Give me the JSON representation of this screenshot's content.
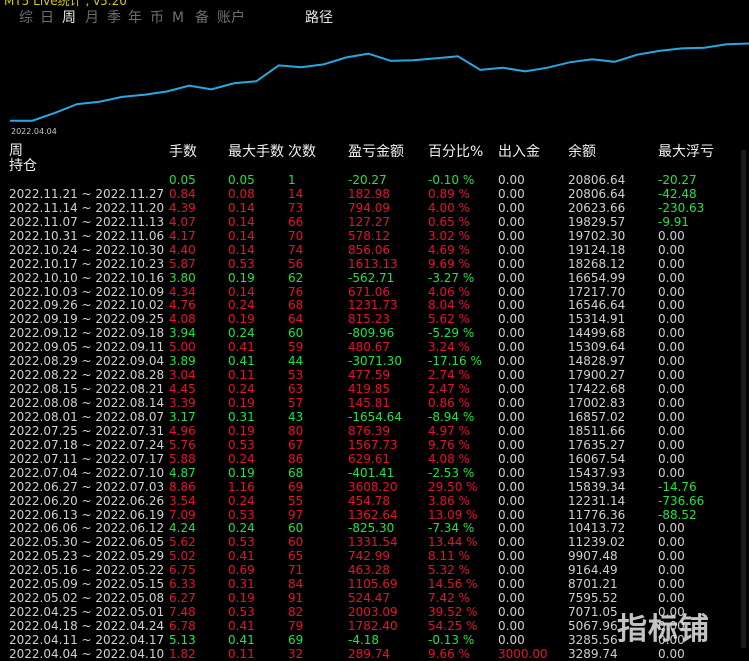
{
  "app": {
    "title_fragment": "MT5 Live统计 , v5.20"
  },
  "tabs": [
    {
      "label": "综"
    },
    {
      "label": "日"
    },
    {
      "label": "周"
    },
    {
      "label": "月"
    },
    {
      "label": "季"
    },
    {
      "label": "年"
    },
    {
      "label": "币"
    },
    {
      "label": "M"
    },
    {
      "label": "备"
    },
    {
      "label": "账户"
    },
    {
      "label": "路径"
    }
  ],
  "chart": {
    "start_date_label": "2022.04.04",
    "line_color": "#29a8e0"
  },
  "chart_data": {
    "type": "line",
    "title": "",
    "xlabel": "",
    "ylabel": "",
    "x_start_label": "2022.04.04",
    "x": [
      "2022.04.04",
      "2022.04.11",
      "2022.04.18",
      "2022.04.25",
      "2022.05.02",
      "2022.05.09",
      "2022.05.16",
      "2022.05.23",
      "2022.05.30",
      "2022.06.06",
      "2022.06.13",
      "2022.06.20",
      "2022.06.27",
      "2022.07.04",
      "2022.07.11",
      "2022.07.18",
      "2022.07.25",
      "2022.08.01",
      "2022.08.08",
      "2022.08.15",
      "2022.08.22",
      "2022.08.29",
      "2022.09.05",
      "2022.09.12",
      "2022.09.19",
      "2022.09.26",
      "2022.10.03",
      "2022.10.10",
      "2022.10.17",
      "2022.10.24",
      "2022.10.31",
      "2022.11.07",
      "2022.11.14",
      "2022.11.21"
    ],
    "series": [
      {
        "values": [
          3289.74,
          3285.56,
          5067.96,
          7071.05,
          7595.52,
          8701.21,
          9164.49,
          9907.48,
          11239.02,
          10413.72,
          11776.36,
          12231.14,
          15839.34,
          15437.93,
          16067.54,
          17635.27,
          18511.66,
          16857.02,
          17002.83,
          17422.68,
          17900.27,
          14828.97,
          15309.64,
          14499.68,
          15314.91,
          16546.64,
          17217.7,
          16654.99,
          18268.12,
          19124.18,
          19702.3,
          19829.57,
          20623.66,
          20806.64
        ]
      }
    ]
  },
  "table": {
    "headers": {
      "period_top": "周",
      "period_bottom": "持仓",
      "lots": "手数",
      "max_lots": "最大手数",
      "count": "次数",
      "pnl": "盈亏金额",
      "pct": "百分比%",
      "io": "出入金",
      "balance": "余额",
      "max_float": "最大浮亏"
    },
    "rows": [
      {
        "period": "",
        "lots": "0.05",
        "max_lots": "0.05",
        "count": "1",
        "pnl": "-20.27",
        "pct": "-0.10 %",
        "io": "0.00",
        "balance": "20806.64",
        "max_float": "-20.27",
        "color": "g",
        "fcolor": "g"
      },
      {
        "period": "2022.11.21 ~ 2022.11.27",
        "lots": "0.84",
        "max_lots": "0.08",
        "count": "14",
        "pnl": "182.98",
        "pct": "0.89 %",
        "io": "0.00",
        "balance": "20806.64",
        "max_float": "-42.48",
        "color": "r",
        "fcolor": "g"
      },
      {
        "period": "2022.11.14 ~ 2022.11.20",
        "lots": "4.39",
        "max_lots": "0.14",
        "count": "73",
        "pnl": "794.09",
        "pct": "4.00 %",
        "io": "0.00",
        "balance": "20623.66",
        "max_float": "-230.63",
        "color": "r",
        "fcolor": "g"
      },
      {
        "period": "2022.11.07 ~ 2022.11.13",
        "lots": "4.07",
        "max_lots": "0.14",
        "count": "66",
        "pnl": "127.27",
        "pct": "0.65 %",
        "io": "0.00",
        "balance": "19829.57",
        "max_float": "-9.91",
        "color": "r",
        "fcolor": "g"
      },
      {
        "period": "2022.10.31 ~ 2022.11.06",
        "lots": "4.17",
        "max_lots": "0.14",
        "count": "70",
        "pnl": "578.12",
        "pct": "3.02 %",
        "io": "0.00",
        "balance": "19702.30",
        "max_float": "0.00",
        "color": "r",
        "fcolor": "w"
      },
      {
        "period": "2022.10.24 ~ 2022.10.30",
        "lots": "4.40",
        "max_lots": "0.14",
        "count": "74",
        "pnl": "856.06",
        "pct": "4.69 %",
        "io": "0.00",
        "balance": "19124.18",
        "max_float": "0.00",
        "color": "r",
        "fcolor": "w"
      },
      {
        "period": "2022.10.17 ~ 2022.10.23",
        "lots": "5.87",
        "max_lots": "0.53",
        "count": "56",
        "pnl": "1613.13",
        "pct": "9.69 %",
        "io": "0.00",
        "balance": "18268.12",
        "max_float": "0.00",
        "color": "r",
        "fcolor": "w"
      },
      {
        "period": "2022.10.10 ~ 2022.10.16",
        "lots": "3.80",
        "max_lots": "0.19",
        "count": "62",
        "pnl": "-562.71",
        "pct": "-3.27 %",
        "io": "0.00",
        "balance": "16654.99",
        "max_float": "0.00",
        "color": "g",
        "fcolor": "w"
      },
      {
        "period": "2022.10.03 ~ 2022.10.09",
        "lots": "4.34",
        "max_lots": "0.14",
        "count": "76",
        "pnl": "671.06",
        "pct": "4.06 %",
        "io": "0.00",
        "balance": "17217.70",
        "max_float": "0.00",
        "color": "r",
        "fcolor": "w"
      },
      {
        "period": "2022.09.26 ~ 2022.10.02",
        "lots": "4.76",
        "max_lots": "0.24",
        "count": "68",
        "pnl": "1231.73",
        "pct": "8.04 %",
        "io": "0.00",
        "balance": "16546.64",
        "max_float": "0.00",
        "color": "r",
        "fcolor": "w"
      },
      {
        "period": "2022.09.19 ~ 2022.09.25",
        "lots": "4.08",
        "max_lots": "0.19",
        "count": "64",
        "pnl": "815.23",
        "pct": "5.62 %",
        "io": "0.00",
        "balance": "15314.91",
        "max_float": "0.00",
        "color": "r",
        "fcolor": "w"
      },
      {
        "period": "2022.09.12 ~ 2022.09.18",
        "lots": "3.94",
        "max_lots": "0.24",
        "count": "60",
        "pnl": "-809.96",
        "pct": "-5.29 %",
        "io": "0.00",
        "balance": "14499.68",
        "max_float": "0.00",
        "color": "g",
        "fcolor": "w"
      },
      {
        "period": "2022.09.05 ~ 2022.09.11",
        "lots": "5.00",
        "max_lots": "0.41",
        "count": "59",
        "pnl": "480.67",
        "pct": "3.24 %",
        "io": "0.00",
        "balance": "15309.64",
        "max_float": "0.00",
        "color": "r",
        "fcolor": "w"
      },
      {
        "period": "2022.08.29 ~ 2022.09.04",
        "lots": "3.89",
        "max_lots": "0.41",
        "count": "44",
        "pnl": "-3071.30",
        "pct": "-17.16 %",
        "io": "0.00",
        "balance": "14828.97",
        "max_float": "0.00",
        "color": "g",
        "fcolor": "w"
      },
      {
        "period": "2022.08.22 ~ 2022.08.28",
        "lots": "3.04",
        "max_lots": "0.11",
        "count": "53",
        "pnl": "477.59",
        "pct": "2.74 %",
        "io": "0.00",
        "balance": "17900.27",
        "max_float": "0.00",
        "color": "r",
        "fcolor": "w"
      },
      {
        "period": "2022.08.15 ~ 2022.08.21",
        "lots": "4.45",
        "max_lots": "0.24",
        "count": "63",
        "pnl": "419.85",
        "pct": "2.47 %",
        "io": "0.00",
        "balance": "17422.68",
        "max_float": "0.00",
        "color": "r",
        "fcolor": "w"
      },
      {
        "period": "2022.08.08 ~ 2022.08.14",
        "lots": "3.39",
        "max_lots": "0.19",
        "count": "57",
        "pnl": "145.81",
        "pct": "0.86 %",
        "io": "0.00",
        "balance": "17002.83",
        "max_float": "0.00",
        "color": "r",
        "fcolor": "w"
      },
      {
        "period": "2022.08.01 ~ 2022.08.07",
        "lots": "3.17",
        "max_lots": "0.31",
        "count": "43",
        "pnl": "-1654.64",
        "pct": "-8.94 %",
        "io": "0.00",
        "balance": "16857.02",
        "max_float": "0.00",
        "color": "g",
        "fcolor": "w"
      },
      {
        "period": "2022.07.25 ~ 2022.07.31",
        "lots": "4.96",
        "max_lots": "0.19",
        "count": "80",
        "pnl": "876.39",
        "pct": "4.97 %",
        "io": "0.00",
        "balance": "18511.66",
        "max_float": "0.00",
        "color": "r",
        "fcolor": "w"
      },
      {
        "period": "2022.07.18 ~ 2022.07.24",
        "lots": "5.76",
        "max_lots": "0.53",
        "count": "67",
        "pnl": "1567.73",
        "pct": "9.76 %",
        "io": "0.00",
        "balance": "17635.27",
        "max_float": "0.00",
        "color": "r",
        "fcolor": "w"
      },
      {
        "period": "2022.07.11 ~ 2022.07.17",
        "lots": "5.88",
        "max_lots": "0.24",
        "count": "86",
        "pnl": "629.61",
        "pct": "4.08 %",
        "io": "0.00",
        "balance": "16067.54",
        "max_float": "0.00",
        "color": "r",
        "fcolor": "w"
      },
      {
        "period": "2022.07.04 ~ 2022.07.10",
        "lots": "4.87",
        "max_lots": "0.19",
        "count": "68",
        "pnl": "-401.41",
        "pct": "-2.53 %",
        "io": "0.00",
        "balance": "15437.93",
        "max_float": "0.00",
        "color": "g",
        "fcolor": "w"
      },
      {
        "period": "2022.06.27 ~ 2022.07.03",
        "lots": "8.86",
        "max_lots": "1.16",
        "count": "69",
        "pnl": "3608.20",
        "pct": "29.50 %",
        "io": "0.00",
        "balance": "15839.34",
        "max_float": "-14.76",
        "color": "r",
        "fcolor": "g"
      },
      {
        "period": "2022.06.20 ~ 2022.06.26",
        "lots": "3.54",
        "max_lots": "0.24",
        "count": "55",
        "pnl": "454.78",
        "pct": "3.86 %",
        "io": "0.00",
        "balance": "12231.14",
        "max_float": "-736.66",
        "color": "r",
        "fcolor": "g"
      },
      {
        "period": "2022.06.13 ~ 2022.06.19",
        "lots": "7.09",
        "max_lots": "0.53",
        "count": "97",
        "pnl": "1362.64",
        "pct": "13.09 %",
        "io": "0.00",
        "balance": "11776.36",
        "max_float": "-88.52",
        "color": "r",
        "fcolor": "g"
      },
      {
        "period": "2022.06.06 ~ 2022.06.12",
        "lots": "4.24",
        "max_lots": "0.24",
        "count": "60",
        "pnl": "-825.30",
        "pct": "-7.34 %",
        "io": "0.00",
        "balance": "10413.72",
        "max_float": "0.00",
        "color": "g",
        "fcolor": "w"
      },
      {
        "period": "2022.05.30 ~ 2022.06.05",
        "lots": "5.62",
        "max_lots": "0.53",
        "count": "60",
        "pnl": "1331.54",
        "pct": "13.44 %",
        "io": "0.00",
        "balance": "11239.02",
        "max_float": "0.00",
        "color": "r",
        "fcolor": "w"
      },
      {
        "period": "2022.05.23 ~ 2022.05.29",
        "lots": "5.02",
        "max_lots": "0.41",
        "count": "65",
        "pnl": "742.99",
        "pct": "8.11 %",
        "io": "0.00",
        "balance": "9907.48",
        "max_float": "0.00",
        "color": "r",
        "fcolor": "w"
      },
      {
        "period": "2022.05.16 ~ 2022.05.22",
        "lots": "6.75",
        "max_lots": "0.69",
        "count": "71",
        "pnl": "463.28",
        "pct": "5.32 %",
        "io": "0.00",
        "balance": "9164.49",
        "max_float": "0.00",
        "color": "r",
        "fcolor": "w"
      },
      {
        "period": "2022.05.09 ~ 2022.05.15",
        "lots": "6.33",
        "max_lots": "0.31",
        "count": "84",
        "pnl": "1105.69",
        "pct": "14.56 %",
        "io": "0.00",
        "balance": "8701.21",
        "max_float": "0.00",
        "color": "r",
        "fcolor": "w"
      },
      {
        "period": "2022.05.02 ~ 2022.05.08",
        "lots": "6.27",
        "max_lots": "0.19",
        "count": "91",
        "pnl": "524.47",
        "pct": "7.42 %",
        "io": "0.00",
        "balance": "7595.52",
        "max_float": "0.00",
        "color": "r",
        "fcolor": "w"
      },
      {
        "period": "2022.04.25 ~ 2022.05.01",
        "lots": "7.48",
        "max_lots": "0.53",
        "count": "82",
        "pnl": "2003.09",
        "pct": "39.52 %",
        "io": "0.00",
        "balance": "7071.05",
        "max_float": "0.00",
        "color": "r",
        "fcolor": "w"
      },
      {
        "period": "2022.04.18 ~ 2022.04.24",
        "lots": "6.78",
        "max_lots": "0.41",
        "count": "79",
        "pnl": "1782.40",
        "pct": "54.25 %",
        "io": "0.00",
        "balance": "5067.96",
        "max_float": "0.00",
        "color": "r",
        "fcolor": "w"
      },
      {
        "period": "2022.04.11 ~ 2022.04.17",
        "lots": "5.13",
        "max_lots": "0.41",
        "count": "69",
        "pnl": "-4.18",
        "pct": "-0.13 %",
        "io": "0.00",
        "balance": "3285.56",
        "max_float": "0.00",
        "color": "g",
        "fcolor": "w"
      },
      {
        "period": "2022.04.04 ~ 2022.04.10",
        "lots": "1.82",
        "max_lots": "0.11",
        "count": "32",
        "pnl": "289.74",
        "pct": "9.66 %",
        "io": "3000.00",
        "balance": "3289.74",
        "max_float": "0.00",
        "color": "r",
        "fcolor": "w",
        "iocolor": "r"
      }
    ]
  },
  "watermark": "指标铺",
  "colors": {
    "positive": "#e8112d",
    "negative": "#21e341",
    "neutral": "#d0d0d0",
    "background": "#000000"
  }
}
